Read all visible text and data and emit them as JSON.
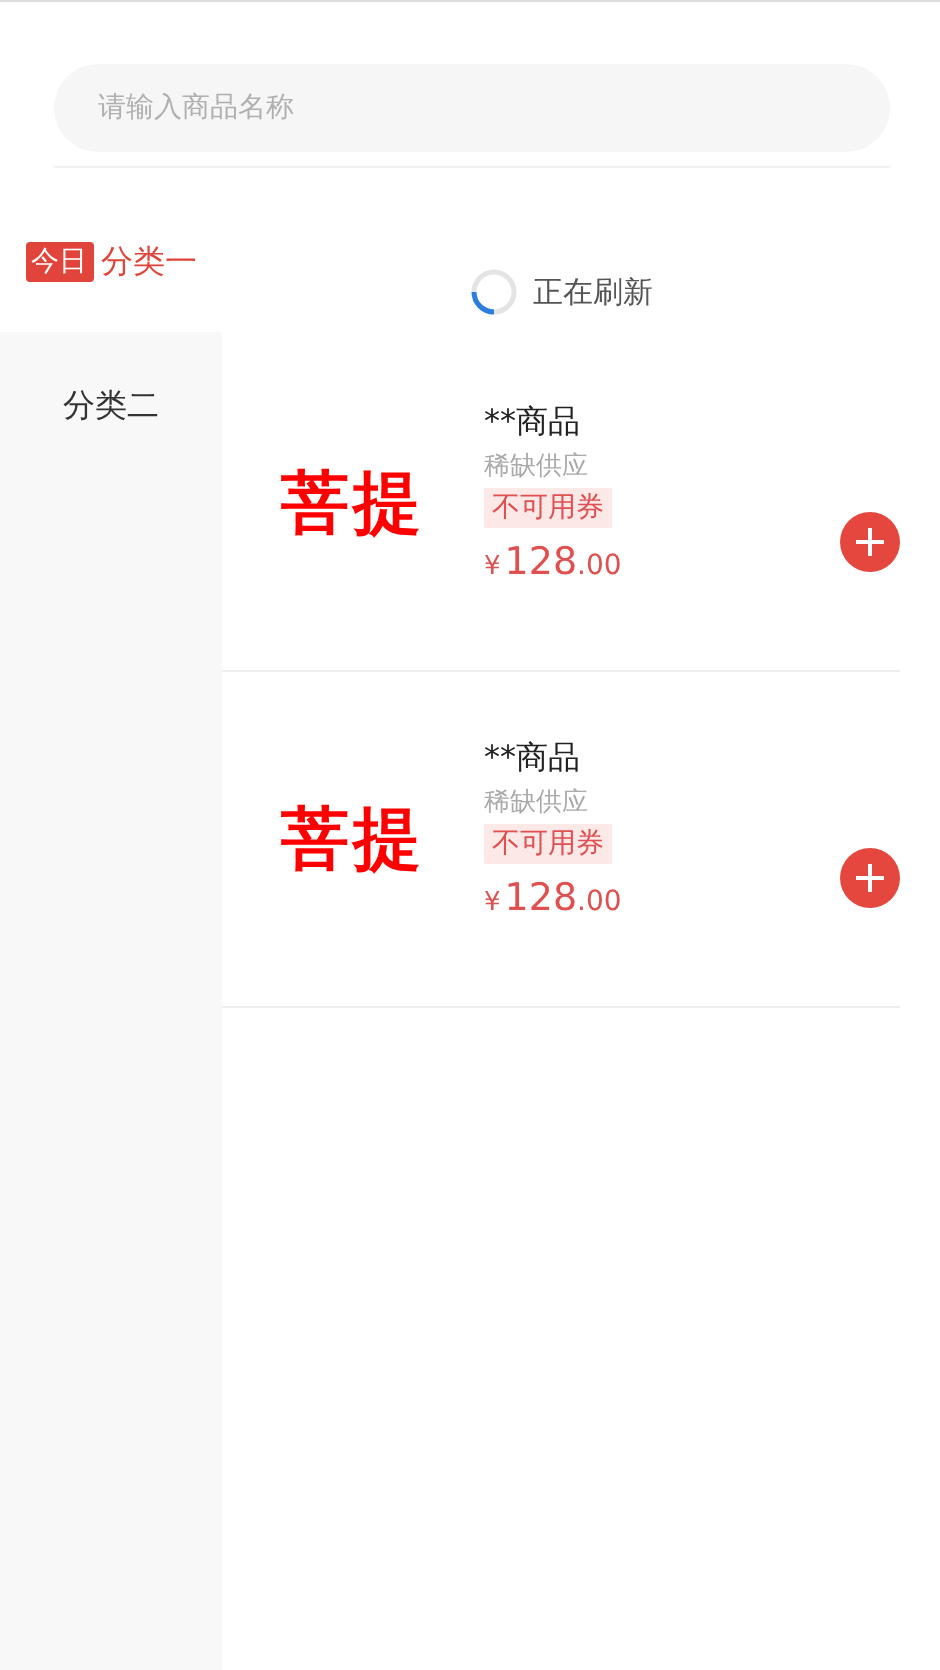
{
  "search": {
    "placeholder": "请输入商品名称"
  },
  "categories": [
    {
      "label": "分类一",
      "badge": "今日",
      "selected": true
    },
    {
      "label": "分类二",
      "selected": false
    }
  ],
  "refresh": {
    "text": "正在刷新"
  },
  "products": [
    {
      "image_text": "菩提",
      "name": "**商品",
      "subtitle": "稀缺供应",
      "tag": "不可用券",
      "currency": "¥",
      "price_integer": "128",
      "price_decimal": ".00"
    },
    {
      "image_text": "菩提",
      "name": "**商品",
      "subtitle": "稀缺供应",
      "tag": "不可用券",
      "currency": "¥",
      "price_integer": "128",
      "price_decimal": ".00"
    }
  ]
}
